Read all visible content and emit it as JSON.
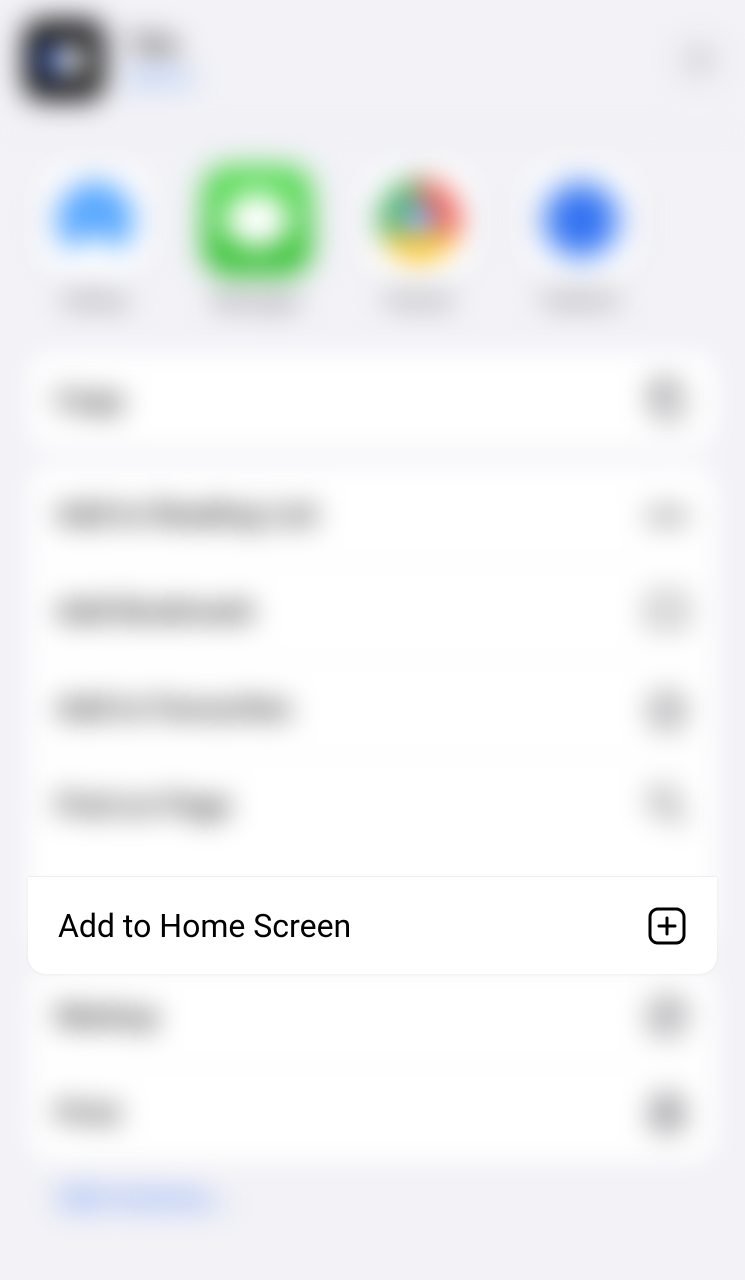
{
  "header": {
    "title": "Title",
    "subtitle": "options"
  },
  "share_apps": [
    {
      "name": "AirDrop"
    },
    {
      "name": "Messages"
    },
    {
      "name": "Chrome"
    },
    {
      "name": "Freeform"
    }
  ],
  "copy": {
    "label": "Copy"
  },
  "actions_primary": [
    {
      "label": "Add to Reading List"
    },
    {
      "label": "Add Bookmark"
    },
    {
      "label": "Add to Favourites"
    },
    {
      "label": "Find on Page"
    },
    {
      "label": "Add to Home Screen"
    }
  ],
  "actions_secondary": [
    {
      "label": "Markup"
    },
    {
      "label": "Print"
    }
  ],
  "footer": {
    "label": "Edit Actions..."
  }
}
